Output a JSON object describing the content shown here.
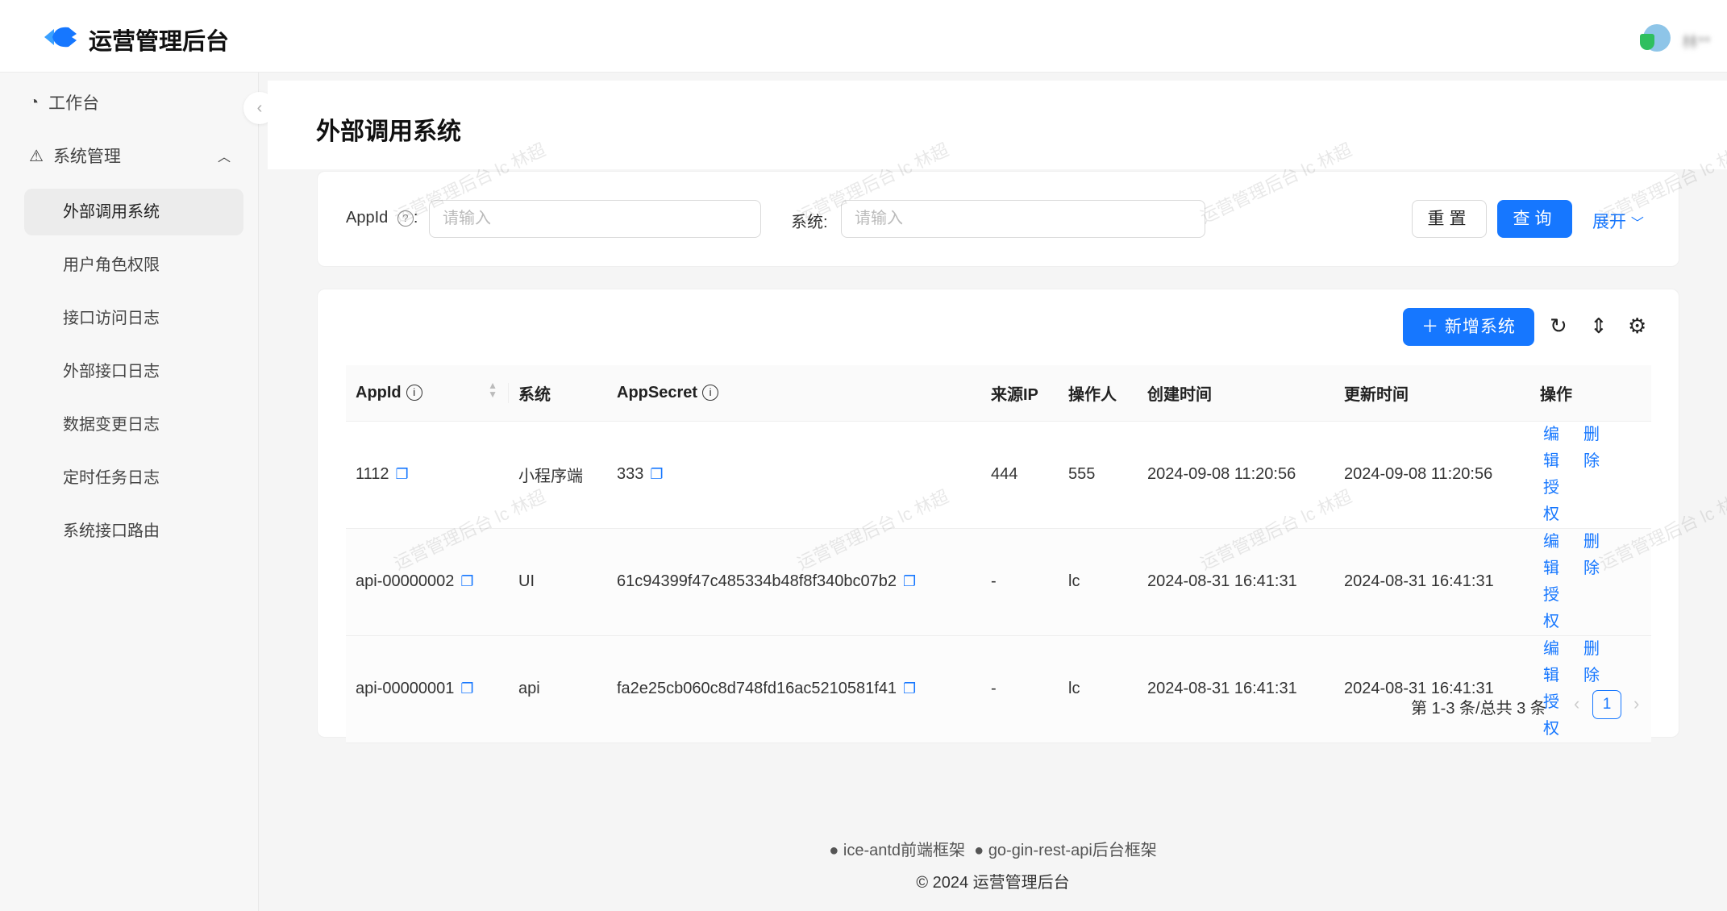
{
  "header": {
    "app_title": "运营管理后台",
    "user_name": "林**"
  },
  "sidebar": {
    "workbench": "工作台",
    "system_mgmt": "系统管理",
    "items": [
      {
        "label": "外部调用系统",
        "active": true
      },
      {
        "label": "用户角色权限"
      },
      {
        "label": "接口访问日志"
      },
      {
        "label": "外部接口日志"
      },
      {
        "label": "数据变更日志"
      },
      {
        "label": "定时任务日志"
      },
      {
        "label": "系统接口路由"
      }
    ]
  },
  "page": {
    "title": "外部调用系统"
  },
  "search": {
    "appid_label": "AppId",
    "appid_placeholder": "请输入",
    "system_label": "系统:",
    "system_placeholder": "请输入",
    "reset": "重置",
    "query": "查询",
    "expand": "展开"
  },
  "toolbar": {
    "add": "新增系统"
  },
  "table": {
    "columns": [
      "AppId",
      "系统",
      "AppSecret",
      "来源IP",
      "操作人",
      "创建时间",
      "更新时间",
      "操作"
    ],
    "rows": [
      {
        "appid": "1112",
        "system": "小程序端",
        "secret": "333",
        "ip": "444",
        "operator": "555",
        "created": "2024-09-08 11:20:56",
        "updated": "2024-09-08 11:20:56"
      },
      {
        "appid": "api-00000002",
        "system": "UI",
        "secret": "61c94399f47c485334b48f8f340bc07b2",
        "ip": "-",
        "operator": "lc",
        "created": "2024-08-31 16:41:31",
        "updated": "2024-08-31 16:41:31"
      },
      {
        "appid": "api-00000001",
        "system": "api",
        "secret": "fa2e25cb060c8d748fd16ac5210581f41",
        "ip": "-",
        "operator": "lc",
        "created": "2024-08-31 16:41:31",
        "updated": "2024-08-31 16:41:31"
      }
    ],
    "actions": {
      "edit": "编辑",
      "delete": "删除",
      "grant": "授权"
    }
  },
  "pagination": {
    "summary": "第 1-3 条/总共 3 条",
    "current": "1"
  },
  "footer": {
    "link1": "ice-antd前端框架",
    "link2": "go-gin-rest-api后台框架",
    "copyright": "© 2024 运营管理后台"
  },
  "watermark": "运营管理后台 lc 林超",
  "colors": {
    "primary": "#1677ff"
  }
}
